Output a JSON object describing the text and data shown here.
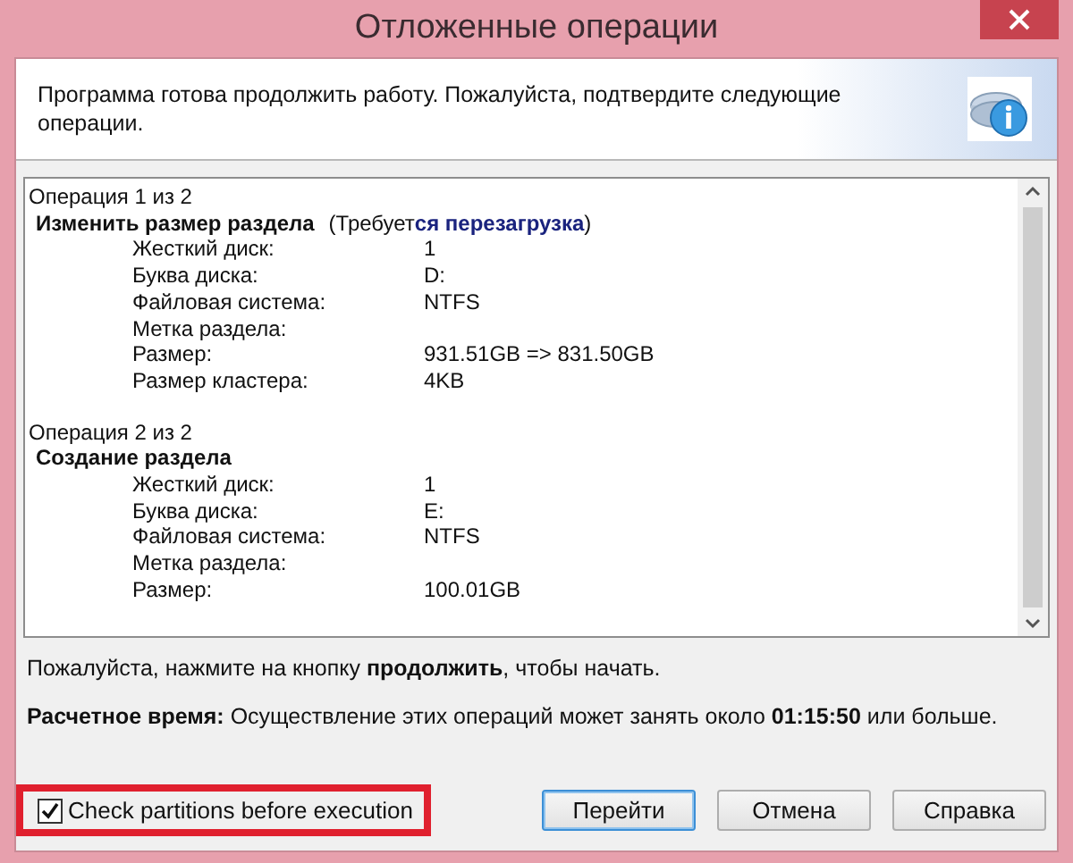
{
  "window": {
    "title": "Отложенные операции"
  },
  "header": {
    "message": "Программа готова продолжить работу. Пожалуйста, подтвердите следующие операции."
  },
  "operations": [
    {
      "counter": "Операция 1 из 2",
      "title": "Изменить размер раздела",
      "note": "(Требует**ся перезагрузка**)",
      "details": [
        {
          "label": "Жесткий диск:",
          "value": "1"
        },
        {
          "label": "Буква диска:",
          "value": "D:"
        },
        {
          "label": "Файловая система:",
          "value": "NTFS"
        },
        {
          "label": "Метка раздела:"
        },
        {
          "label": "Размер:",
          "value": "931.51GB => 831.50GB"
        },
        {
          "label": "Размер кластера:",
          "value": "4KB"
        }
      ]
    },
    {
      "counter": "Операция 2 из 2",
      "title": "Создание раздела",
      "details": [
        {
          "label": "Жесткий диск:",
          "value": "1"
        },
        {
          "label": "Буква диска:",
          "value": "E:"
        },
        {
          "label": "Файловая система:",
          "value": "NTFS"
        },
        {
          "label": "Метка раздела:"
        },
        {
          "label": "Размер:",
          "value": "100.01GB"
        }
      ]
    }
  ],
  "instruction": "Пожалуйста, нажмите на кнопку **продолжить**, чтобы начать.",
  "estimate": "**Расчетное время:** Осуществление этих операций может занять около **01:15:50** или больше.",
  "check_option": {
    "label": "Check partitions before execution",
    "checked": true,
    "highlighted": true
  },
  "buttons": [
    {
      "label": "Перейти",
      "focused": true
    },
    {
      "label": "Отмена",
      "focused": false
    },
    {
      "label": "Справка",
      "focused": false
    }
  ]
}
